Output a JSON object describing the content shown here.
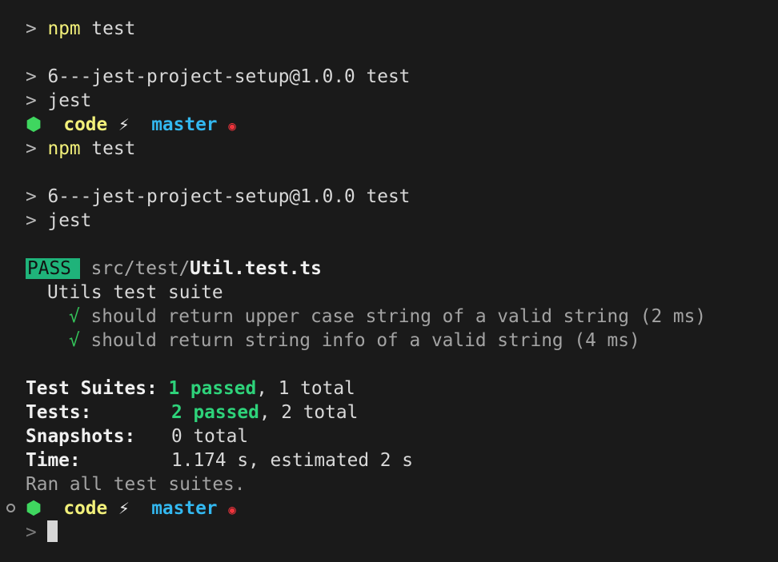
{
  "prompt_symbol": ">",
  "commands": {
    "npm": "npm",
    "test": "test",
    "jest": "jest"
  },
  "script_header": "6---jest-project-setup@1.0.0 test",
  "git_prompt": {
    "hex_icon": "⬢",
    "dir": "code",
    "bolt_icon": "⚡",
    "branch": "master",
    "status_icon": "◉"
  },
  "result": {
    "badge": "PASS",
    "path_prefix": "src/test/",
    "file": "Util.test.ts",
    "suite_name": "Utils test suite",
    "check_icon": "√",
    "tests": [
      "should return upper case string of a valid string (2 ms)",
      "should return string info of a valid string (4 ms)"
    ]
  },
  "summary": {
    "suites_label": "Test Suites:",
    "suites_passed": "1 passed",
    "suites_total": ", 1 total",
    "tests_label": "Tests:",
    "tests_passed": "2 passed",
    "tests_total": ", 2 total",
    "snapshots_label": "Snapshots:",
    "snapshots_value": "0 total",
    "time_label": "Time:",
    "time_value": "1.174 s, estimated 2 s",
    "ran_all": "Ran all test suites."
  }
}
